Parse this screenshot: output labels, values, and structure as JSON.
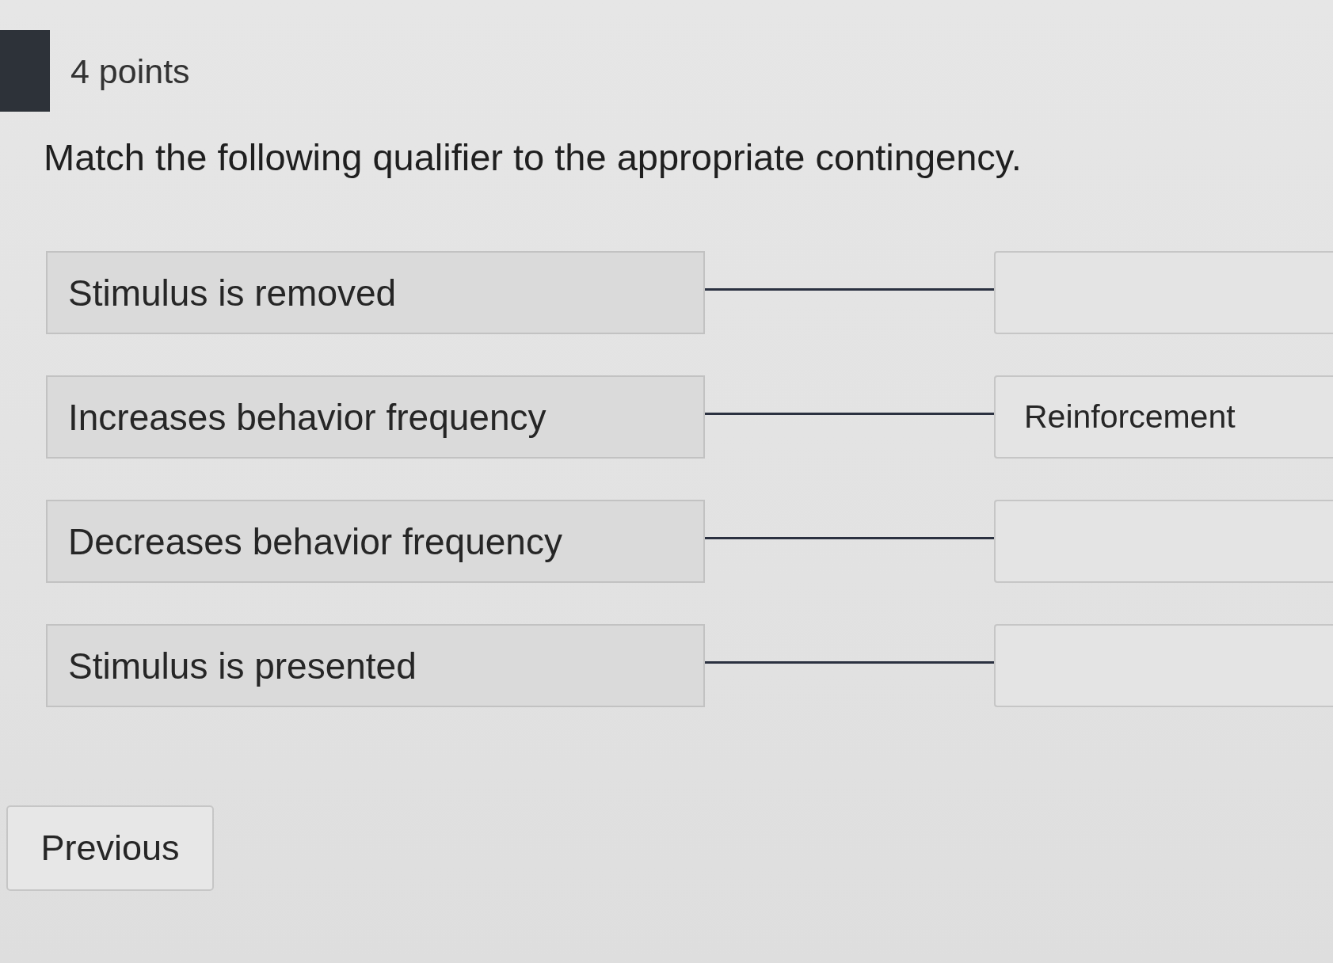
{
  "header": {
    "points": "4 points"
  },
  "question": "Match the following qualifier to the appropriate contingency.",
  "pairs": [
    {
      "prompt": "Stimulus is removed"
    },
    {
      "prompt": "Increases behavior frequency",
      "answer": "Reinforcement"
    },
    {
      "prompt": "Decreases behavior frequency"
    },
    {
      "prompt": "Stimulus is presented"
    }
  ],
  "navigation": {
    "previous": "Previous"
  }
}
